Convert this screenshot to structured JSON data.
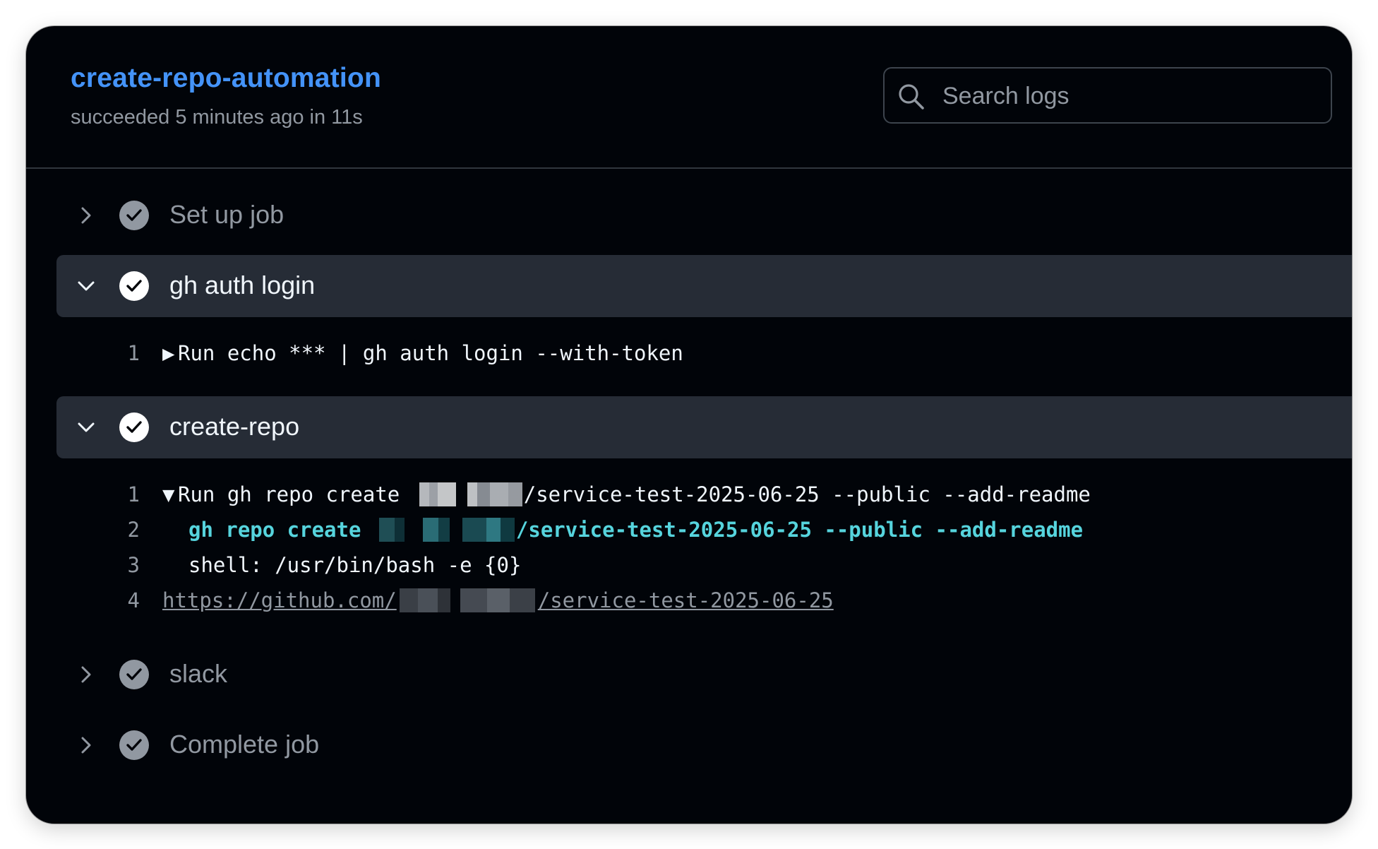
{
  "job": {
    "title": "create-repo-automation",
    "status": "succeeded 5 minutes ago in 11s"
  },
  "search": {
    "placeholder": "Search logs"
  },
  "steps": [
    {
      "label": "Set up job",
      "state": "collapsed",
      "status": "success"
    },
    {
      "label": "gh auth login",
      "state": "expanded",
      "status": "success",
      "lines": [
        {
          "num": "1",
          "text": "Run echo *** | gh auth login --with-token"
        }
      ]
    },
    {
      "label": "create-repo",
      "state": "expanded",
      "status": "success",
      "lines": [
        {
          "num": "1",
          "prefix": "Run gh repo create ",
          "suffix": "/service-test-2025-06-25 --public --add-readme"
        },
        {
          "num": "2",
          "prefix": "gh repo create ",
          "suffix": "/service-test-2025-06-25 --public --add-readme"
        },
        {
          "num": "3",
          "text": "shell: /usr/bin/bash -e {0}"
        },
        {
          "num": "4",
          "prefix": "https://github.com/",
          "suffix": "/service-test-2025-06-25"
        }
      ]
    },
    {
      "label": "slack",
      "state": "collapsed",
      "status": "success"
    },
    {
      "label": "Complete job",
      "state": "collapsed",
      "status": "success"
    }
  ],
  "colors": {
    "background": "#010409",
    "title": "#4493f8",
    "expanded_row": "#262c36",
    "command_highlight": "#56d4dd",
    "muted": "#9198a1"
  },
  "icons": {
    "search": "search-icon",
    "collapsed": "chevron-right-icon",
    "expanded": "chevron-down-icon",
    "status": "check-circle-icon",
    "log_collapsed": "triangle-right-icon",
    "log_expanded": "triangle-down-icon"
  }
}
